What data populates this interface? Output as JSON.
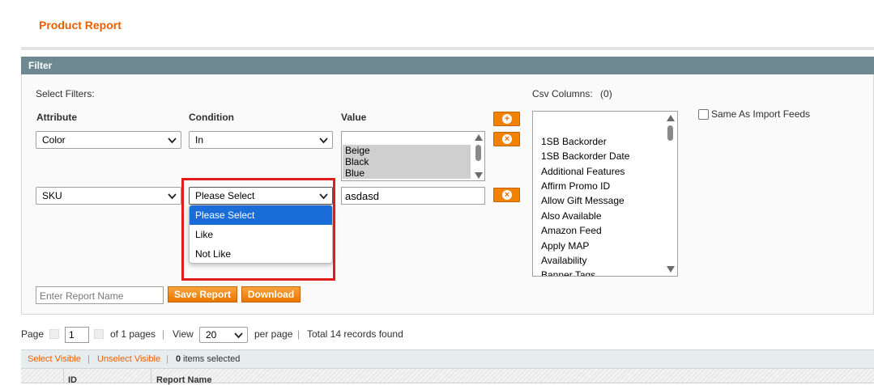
{
  "page": {
    "title": "Product Report"
  },
  "filter": {
    "header": "Filter",
    "select_filters_label": "Select Filters:",
    "columns": {
      "attribute": "Attribute",
      "condition": "Condition",
      "value": "Value"
    },
    "rows": [
      {
        "attribute": "Color",
        "condition": "In",
        "value_options": [
          "Beige",
          "Black",
          "Blue"
        ]
      },
      {
        "attribute": "SKU",
        "condition": "Please Select",
        "value": "asdasd"
      }
    ],
    "condition_dropdown": {
      "options": [
        "Please Select",
        "Like",
        "Not Like"
      ],
      "selected": "Please Select"
    },
    "add_icon": "plus-circle-icon",
    "remove_icon": "x-circle-icon",
    "report_name_placeholder": "Enter Report Name",
    "save_report_label": "Save Report",
    "download_label": "Download",
    "csv": {
      "label": "Csv Columns:",
      "count": "(0)",
      "items": [
        "1SB Backorder",
        "1SB Backorder Date",
        "Additional Features",
        "Affirm Promo ID",
        "Allow Gift Message",
        "Also Available",
        "Amazon Feed",
        "Apply MAP",
        "Availability",
        "Banner Tags"
      ]
    },
    "same_as_import_label": "Same As Import Feeds"
  },
  "pager": {
    "page_label": "Page",
    "page_value": "1",
    "of_pages": "of 1 pages",
    "view_label": "View",
    "per_page_value": "20",
    "per_page_label": "per page",
    "total": "Total 14 records found"
  },
  "massaction": {
    "select_visible": "Select Visible",
    "unselect_visible": "Unselect Visible",
    "items_selected_count": "0",
    "items_selected_text": "items selected"
  },
  "grid": {
    "columns": [
      "ID",
      "Report Name"
    ]
  },
  "colors": {
    "accent": "#eb5e00",
    "header_bg": "#6f8992",
    "button": "#f18200",
    "highlight": "#e21c1c",
    "selected": "#1a6dd9"
  }
}
